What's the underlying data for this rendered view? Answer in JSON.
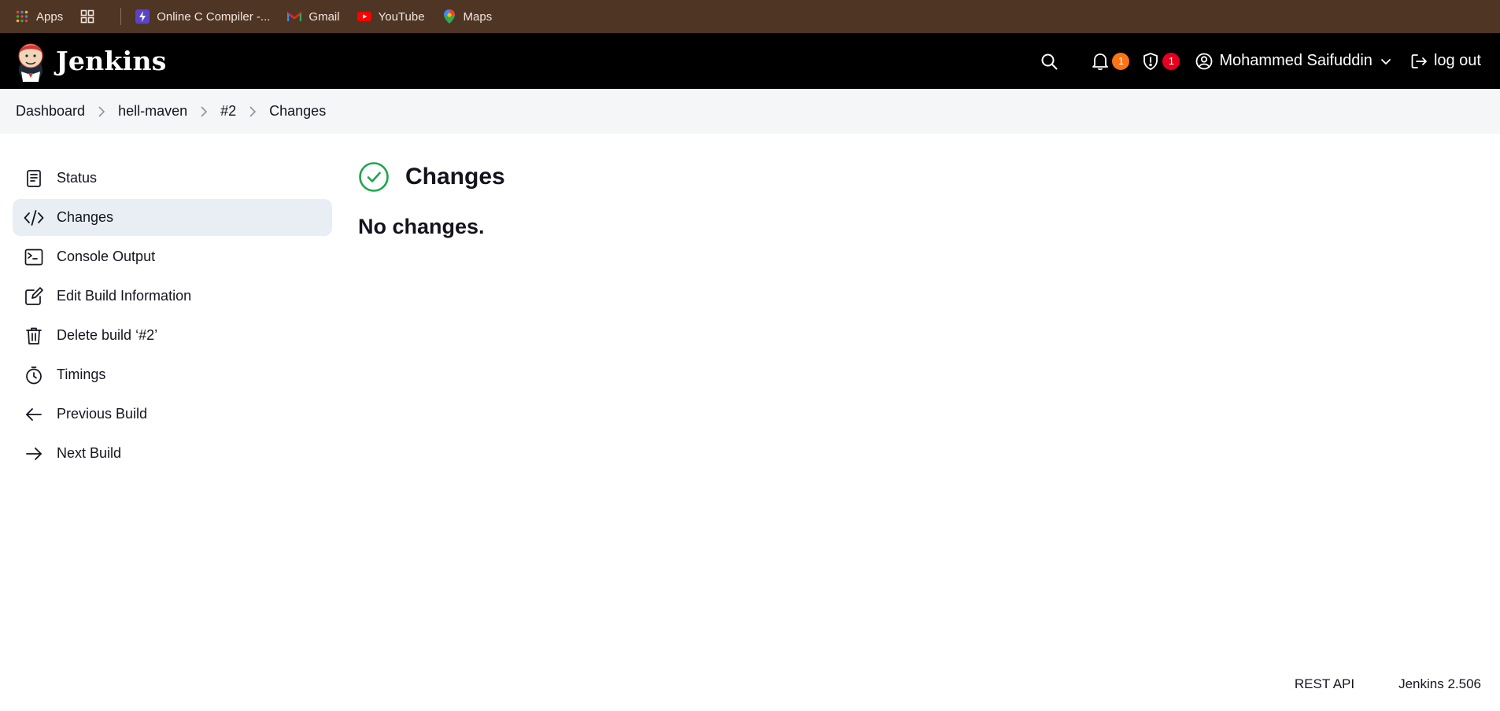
{
  "bookmarks": {
    "apps_label": "Apps",
    "items": [
      {
        "label": "Online C Compiler -...",
        "icon": "bolt-icon"
      },
      {
        "label": "Gmail",
        "icon": "gmail-icon"
      },
      {
        "label": "YouTube",
        "icon": "youtube-icon"
      },
      {
        "label": "Maps",
        "icon": "maps-icon"
      }
    ]
  },
  "header": {
    "brand": "Jenkins",
    "notifications_count": "1",
    "security_count": "1",
    "user_name": "Mohammed Saifuddin",
    "logout_label": "log out"
  },
  "breadcrumb": [
    "Dashboard",
    "hell-maven",
    "#2",
    "Changes"
  ],
  "sidebar": {
    "items": [
      {
        "label": "Status",
        "icon": "document-icon"
      },
      {
        "label": "Changes",
        "icon": "code-icon",
        "active": true
      },
      {
        "label": "Console Output",
        "icon": "terminal-icon"
      },
      {
        "label": "Edit Build Information",
        "icon": "edit-icon"
      },
      {
        "label": "Delete build ‘#2’",
        "icon": "trash-icon"
      },
      {
        "label": "Timings",
        "icon": "stopwatch-icon"
      },
      {
        "label": "Previous Build",
        "icon": "arrow-left-icon"
      },
      {
        "label": "Next Build",
        "icon": "arrow-right-icon"
      }
    ]
  },
  "main": {
    "title": "Changes",
    "message": "No changes."
  },
  "footer": {
    "rest_api": "REST API",
    "version": "Jenkins 2.506"
  },
  "colors": {
    "bookmarks_bg": "#4f3524",
    "header_bg": "#000000",
    "success_green": "#1ea64b",
    "badge_orange": "#fe7313",
    "badge_red": "#e6001f"
  }
}
